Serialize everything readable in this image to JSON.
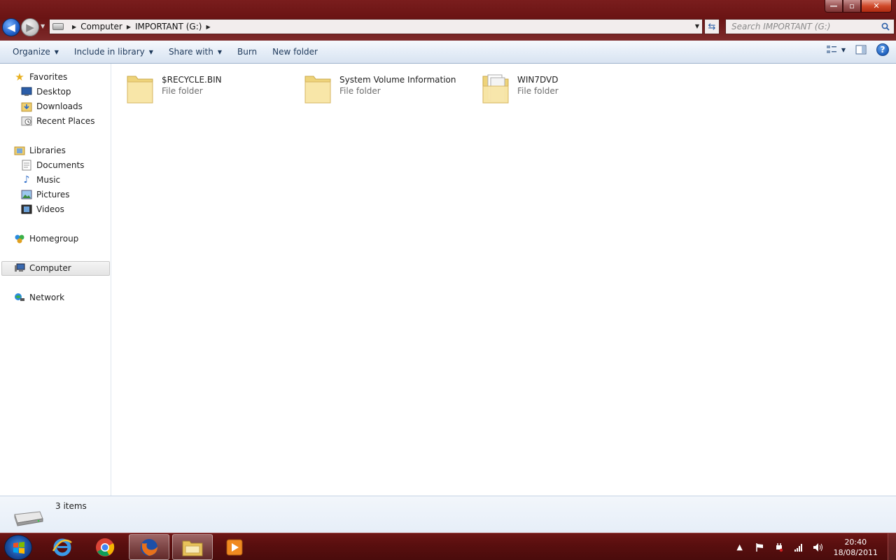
{
  "window": {
    "controls": {
      "minimize": "—",
      "maximize": "▫",
      "close": "✕"
    }
  },
  "address": {
    "crumbs": [
      "Computer",
      "IMPORTANT (G:)"
    ],
    "search_placeholder": "Search IMPORTANT (G:)"
  },
  "toolbar": {
    "organize": "Organize",
    "include_in_library": "Include in library",
    "share_with": "Share with",
    "burn": "Burn",
    "new_folder": "New folder"
  },
  "navpane": {
    "favorites": {
      "label": "Favorites",
      "items": [
        "Desktop",
        "Downloads",
        "Recent Places"
      ]
    },
    "libraries": {
      "label": "Libraries",
      "items": [
        "Documents",
        "Music",
        "Pictures",
        "Videos"
      ]
    },
    "homegroup": "Homegroup",
    "computer": "Computer",
    "network": "Network"
  },
  "files": [
    {
      "name": "$RECYCLE.BIN",
      "type": "File folder"
    },
    {
      "name": "System Volume Information",
      "type": "File folder"
    },
    {
      "name": "WIN7DVD",
      "type": "File folder"
    }
  ],
  "details": {
    "count": "3 items"
  },
  "taskbar": {
    "clock_time": "20:40",
    "clock_date": "18/08/2011"
  },
  "colors": {
    "title_bar": "#6a1414",
    "command_bar": "#e5edf7",
    "link_text": "#1e395b",
    "taskbar": "#5a0f0f"
  }
}
